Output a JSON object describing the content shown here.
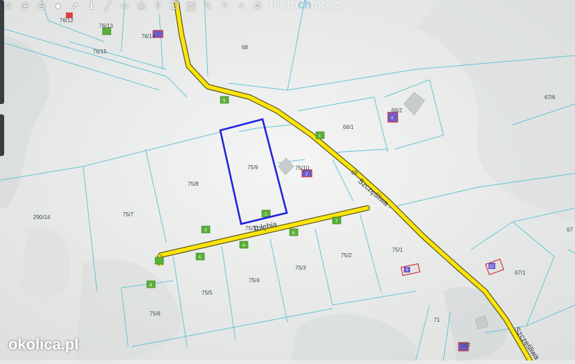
{
  "toolbar": {
    "tools": [
      {
        "icon": "menu-icon",
        "glyph": "≡"
      },
      {
        "icon": "zoom-in-icon",
        "glyph": "⊕"
      },
      {
        "icon": "zoom-out-icon",
        "glyph": "⊖"
      },
      {
        "icon": "circle-icon",
        "glyph": "●"
      },
      {
        "icon": "pointer-icon",
        "glyph": "➚"
      },
      {
        "icon": "info-icon",
        "glyph": "ℹ"
      },
      {
        "icon": "measure-icon",
        "glyph": "╱"
      },
      {
        "icon": "link-icon",
        "glyph": "∞"
      },
      {
        "icon": "print-icon",
        "glyph": "⎙"
      },
      {
        "icon": "download-icon",
        "glyph": "⇩"
      },
      {
        "icon": "copy-icon",
        "glyph": "❐"
      },
      {
        "icon": "layers-icon",
        "glyph": "▦"
      },
      {
        "icon": "comment-icon",
        "glyph": "✎"
      },
      {
        "icon": "help-icon",
        "glyph": "?"
      },
      {
        "icon": "location-icon",
        "glyph": "⌖"
      },
      {
        "icon": "settings-icon",
        "glyph": "⚙"
      }
    ]
  },
  "brand": {
    "prefix": "niero",
    "highlight": "ch",
    "suffix": "mości"
  },
  "watermark": "okolica.pl",
  "roads": {
    "main_name": "Szczęśliwa",
    "side_name": "Tołębia"
  },
  "parcels": [
    "76/12",
    "76/13",
    "76/14",
    "76/15",
    "68",
    "67/6",
    "66/2",
    "66/1",
    "75/9",
    "75/10",
    "69",
    "75/8",
    "75/7",
    "290/14",
    "75/1",
    "67/1",
    "75/2",
    "75/3",
    "75/4",
    "75/5",
    "75/6",
    "71",
    "76/7",
    "75/11",
    "67"
  ],
  "markers": [
    "9",
    "1",
    "2",
    "3",
    "4",
    "5",
    "6",
    "7",
    "8",
    "10",
    "11"
  ],
  "building_labels": [
    "4",
    "2",
    "5",
    "10"
  ],
  "colors": {
    "road": "#ffe40a",
    "parcel_line": "#64c4d6",
    "selection": "#2222dd",
    "marker": "#5cb038"
  }
}
